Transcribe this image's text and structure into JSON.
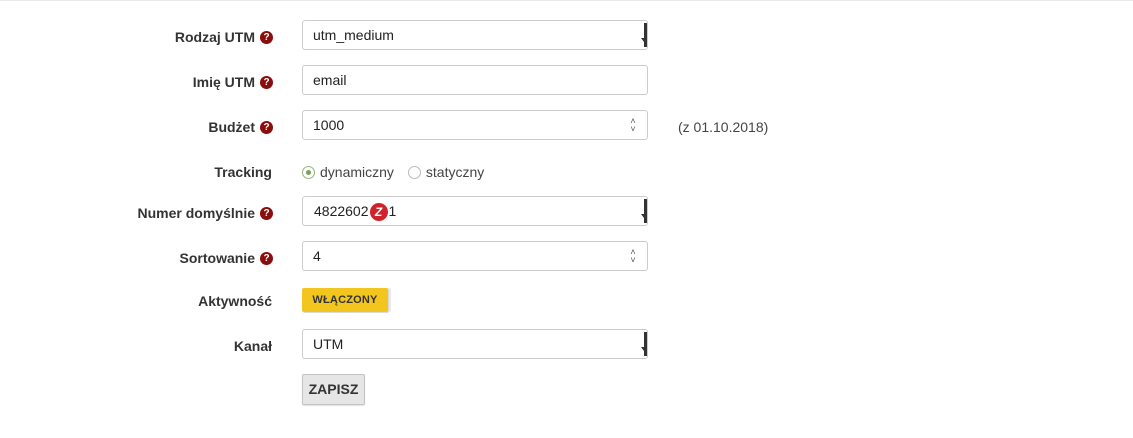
{
  "form": {
    "utm_type": {
      "label": "Rodzaj UTM",
      "value": "utm_medium"
    },
    "utm_name": {
      "label": "Imię UTM",
      "value": "email"
    },
    "budget": {
      "label": "Budżet",
      "value": "1000",
      "note": "(z 01.10.2018)"
    },
    "tracking": {
      "label": "Tracking",
      "options": [
        {
          "label": "dynamiczny",
          "selected": true
        },
        {
          "label": "statyczny",
          "selected": false
        }
      ]
    },
    "default_number": {
      "label": "Numer domyślnie",
      "value_prefix": "4822602",
      "value_suffix": "1",
      "flag_glyph": "Z"
    },
    "sorting": {
      "label": "Sortowanie",
      "value": "4"
    },
    "activity": {
      "label": "Aktywność",
      "toggle_label": "WŁĄCZONY",
      "state": "on"
    },
    "channel": {
      "label": "Kanał",
      "value": "UTM"
    },
    "submit_label": "ZAPISZ"
  },
  "help_glyph": "?",
  "icons": [
    "help-icon",
    "select-arrow-icon",
    "spinner-icon",
    "radio-icon",
    "phone-flag-icon"
  ],
  "colors": {
    "help": "#8b0d0d",
    "toggle_on": "#f3c61f",
    "radio_selected": "#7aa159",
    "flag": "#d0222a"
  }
}
